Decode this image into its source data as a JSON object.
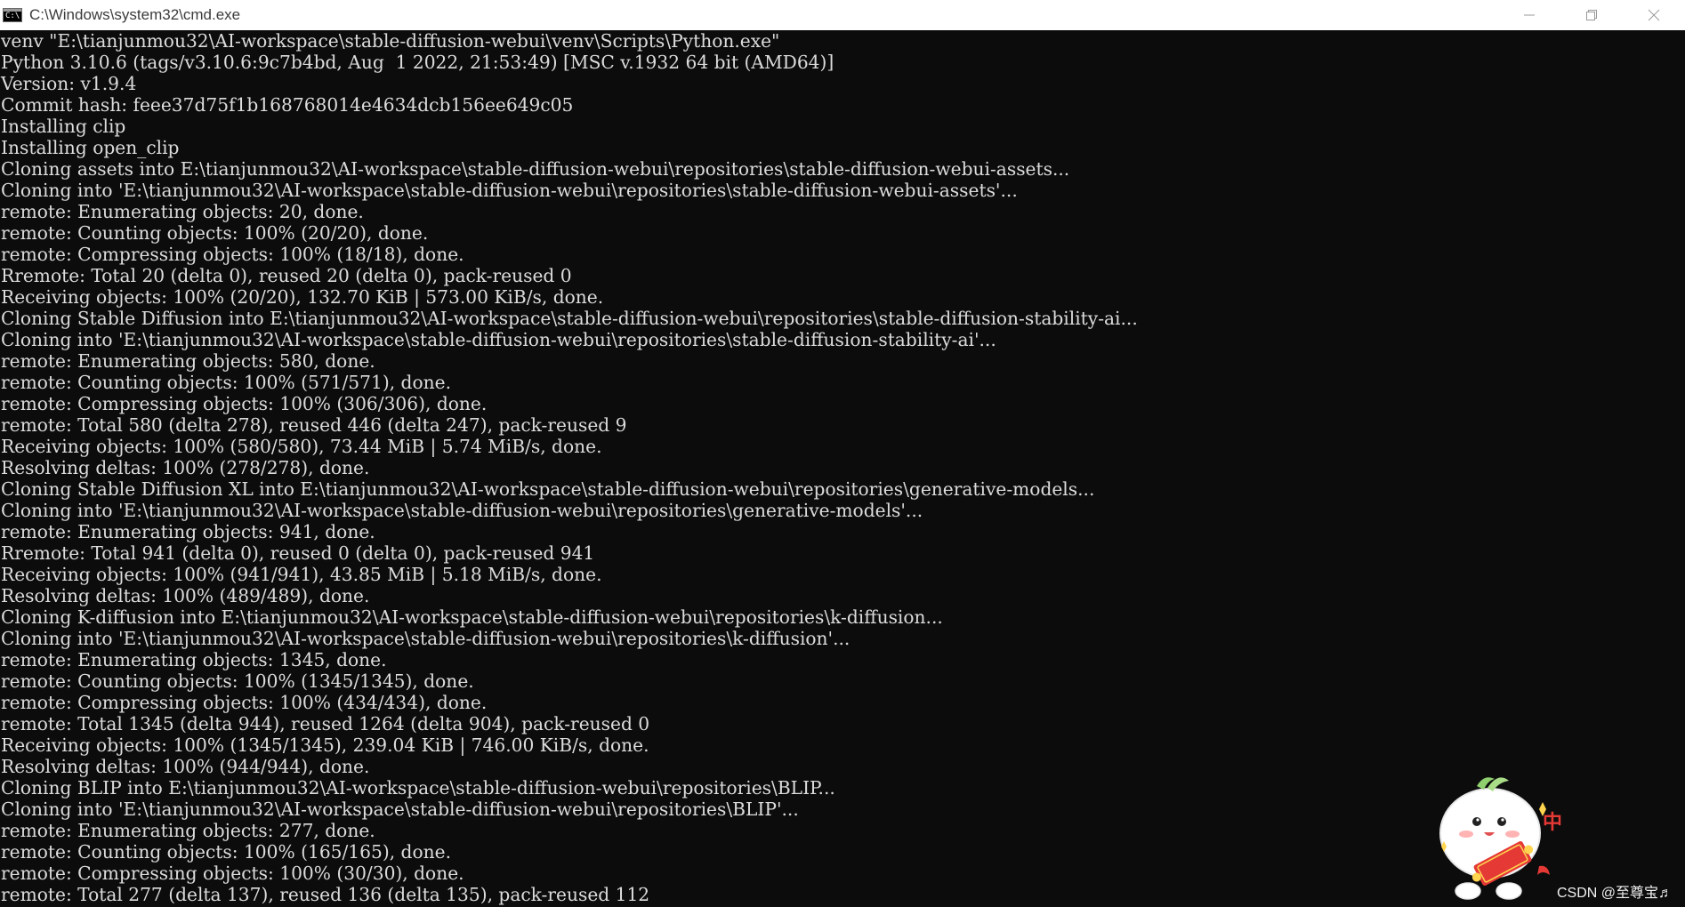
{
  "window": {
    "title": "C:\\Windows\\system32\\cmd.exe",
    "icon": "cmd-console-icon",
    "icon_text": "C:\\."
  },
  "console": {
    "lines": [
      "venv \"E:\\tianjunmou32\\AI-workspace\\stable-diffusion-webui\\venv\\Scripts\\Python.exe\"",
      "Python 3.10.6 (tags/v3.10.6:9c7b4bd, Aug  1 2022, 21:53:49) [MSC v.1932 64 bit (AMD64)]",
      "Version: v1.9.4",
      "Commit hash: feee37d75f1b168768014e4634dcb156ee649c05",
      "Installing clip",
      "Installing open_clip",
      "Cloning assets into E:\\tianjunmou32\\AI-workspace\\stable-diffusion-webui\\repositories\\stable-diffusion-webui-assets...",
      "Cloning into 'E:\\tianjunmou32\\AI-workspace\\stable-diffusion-webui\\repositories\\stable-diffusion-webui-assets'...",
      "remote: Enumerating objects: 20, done.",
      "remote: Counting objects: 100% (20/20), done.",
      "remote: Compressing objects: 100% (18/18), done.",
      "Rremote: Total 20 (delta 0), reused 20 (delta 0), pack-reused 0",
      "Receiving objects: 100% (20/20), 132.70 KiB | 573.00 KiB/s, done.",
      "Cloning Stable Diffusion into E:\\tianjunmou32\\AI-workspace\\stable-diffusion-webui\\repositories\\stable-diffusion-stability-ai...",
      "Cloning into 'E:\\tianjunmou32\\AI-workspace\\stable-diffusion-webui\\repositories\\stable-diffusion-stability-ai'...",
      "remote: Enumerating objects: 580, done.",
      "remote: Counting objects: 100% (571/571), done.",
      "remote: Compressing objects: 100% (306/306), done.",
      "remote: Total 580 (delta 278), reused 446 (delta 247), pack-reused 9",
      "Receiving objects: 100% (580/580), 73.44 MiB | 5.74 MiB/s, done.",
      "Resolving deltas: 100% (278/278), done.",
      "Cloning Stable Diffusion XL into E:\\tianjunmou32\\AI-workspace\\stable-diffusion-webui\\repositories\\generative-models...",
      "Cloning into 'E:\\tianjunmou32\\AI-workspace\\stable-diffusion-webui\\repositories\\generative-models'...",
      "remote: Enumerating objects: 941, done.",
      "Rremote: Total 941 (delta 0), reused 0 (delta 0), pack-reused 941",
      "Receiving objects: 100% (941/941), 43.85 MiB | 5.18 MiB/s, done.",
      "Resolving deltas: 100% (489/489), done.",
      "Cloning K-diffusion into E:\\tianjunmou32\\AI-workspace\\stable-diffusion-webui\\repositories\\k-diffusion...",
      "Cloning into 'E:\\tianjunmou32\\AI-workspace\\stable-diffusion-webui\\repositories\\k-diffusion'...",
      "remote: Enumerating objects: 1345, done.",
      "remote: Counting objects: 100% (1345/1345), done.",
      "remote: Compressing objects: 100% (434/434), done.",
      "remote: Total 1345 (delta 944), reused 1264 (delta 904), pack-reused 0",
      "Receiving objects: 100% (1345/1345), 239.04 KiB | 746.00 KiB/s, done.",
      "Resolving deltas: 100% (944/944), done.",
      "Cloning BLIP into E:\\tianjunmou32\\AI-workspace\\stable-diffusion-webui\\repositories\\BLIP...",
      "Cloning into 'E:\\tianjunmou32\\AI-workspace\\stable-diffusion-webui\\repositories\\BLIP'...",
      "remote: Enumerating objects: 277, done.",
      "remote: Counting objects: 100% (165/165), done.",
      "remote: Compressing objects: 100% (30/30), done.",
      "remote: Total 277 (delta 137), reused 136 (delta 135), pack-reused 112"
    ]
  },
  "colors": {
    "console_bg": "#0c0c0c",
    "console_text": "#dcdcdc",
    "titlebar_bg": "#ffffff"
  },
  "overlay": {
    "sticker_icon": "cartoon-mascot-sticker",
    "sticker_text": "中",
    "watermark": "CSDN @至尊宝♬"
  }
}
